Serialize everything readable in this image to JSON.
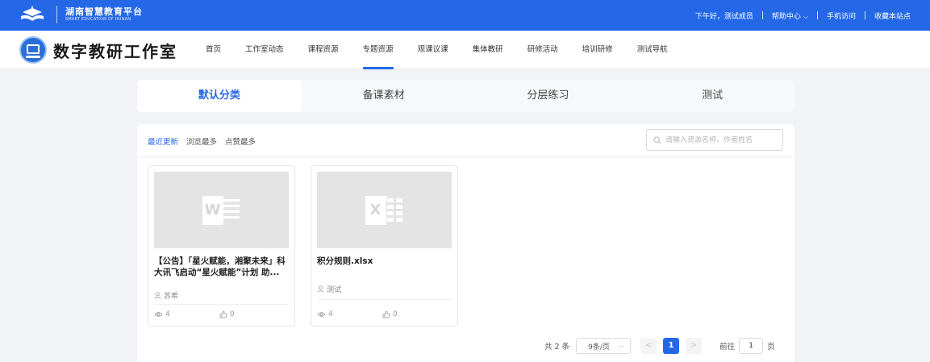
{
  "colors": {
    "primary": "#2468e8",
    "background": "#f2f3f6"
  },
  "topbar": {
    "platform_title": "湖南智慧教育平台",
    "platform_subtitle": "SMART EDUCATION OF HUNAN",
    "greeting": "下午好，测试成员",
    "help_center": "帮助中心",
    "mobile_access": "手机访问",
    "bookmark": "收藏本站点"
  },
  "header": {
    "brand": "数字教研工作室",
    "nav": [
      {
        "label": "首页"
      },
      {
        "label": "工作室动态"
      },
      {
        "label": "课程资源"
      },
      {
        "label": "专题资源",
        "active": true
      },
      {
        "label": "观课议课"
      },
      {
        "label": "集体教研"
      },
      {
        "label": "研修活动"
      },
      {
        "label": "培训研修"
      },
      {
        "label": "测试导航"
      }
    ]
  },
  "tabs": [
    {
      "label": "默认分类",
      "active": true
    },
    {
      "label": "备课素材"
    },
    {
      "label": "分层练习"
    },
    {
      "label": "测试"
    }
  ],
  "sort": {
    "latest": "最近更新",
    "most_viewed": "浏览最多",
    "most_liked": "点赞最多"
  },
  "search": {
    "placeholder": "请输入资源名称、作者姓名"
  },
  "resources": [
    {
      "title": "【公告】「星火赋能，湘聚未来」科大讯飞启动“星火赋能”计划 助...",
      "author": "苏希",
      "views": "4",
      "likes": "0",
      "file_type": "word",
      "icon_letter": "W"
    },
    {
      "title": "积分规则.xlsx",
      "author": "测试",
      "views": "4",
      "likes": "0",
      "file_type": "excel",
      "icon_letter": "X"
    }
  ],
  "pagination": {
    "total": "共 2 条",
    "page_size": "9条/页",
    "prev": "<",
    "current_page": "1",
    "next": ">",
    "goto_label": "前往",
    "goto_value": "1",
    "page_unit": "页"
  }
}
